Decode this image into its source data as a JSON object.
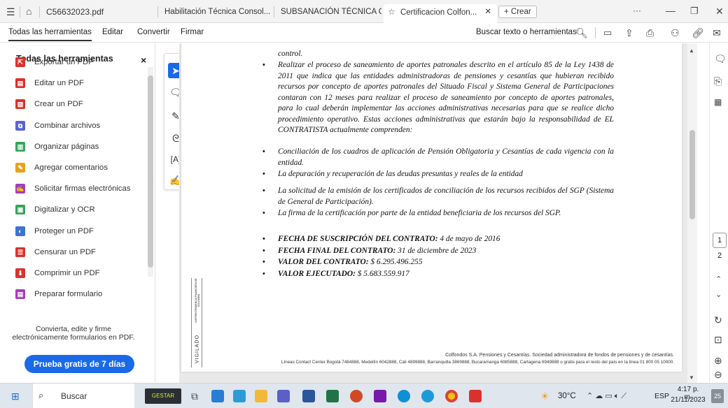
{
  "tabs": [
    {
      "label": "C56632023.pdf"
    },
    {
      "label": "Habilitación Técnica Consol..."
    },
    {
      "label": "SUBSANACIÓN TÉCNICA C..."
    },
    {
      "label": "Certificacion Colfon..."
    }
  ],
  "new_tab_label": "+ Crear",
  "menu": {
    "items": [
      "Todas las herramientas",
      "Editar",
      "Convertir",
      "Firmar"
    ],
    "search_label": "Buscar texto o herramientas"
  },
  "panel": {
    "title": "Todas las herramientas",
    "close": "×",
    "items": [
      {
        "label": "Exportar un PDF",
        "color": "#d9322d"
      },
      {
        "label": "Editar un PDF",
        "color": "#d9322d"
      },
      {
        "label": "Crear un PDF",
        "color": "#d9322d"
      },
      {
        "label": "Combinar archivos",
        "color": "#5b63d3"
      },
      {
        "label": "Organizar páginas",
        "color": "#3aa35c"
      },
      {
        "label": "Agregar comentarios",
        "color": "#e8a21b"
      },
      {
        "label": "Solicitar firmas electrónicas",
        "color": "#a43fb5"
      },
      {
        "label": "Digitalizar y OCR",
        "color": "#3aa35c"
      },
      {
        "label": "Proteger un PDF",
        "color": "#3d73d1"
      },
      {
        "label": "Censurar un PDF",
        "color": "#d9322d"
      },
      {
        "label": "Comprimir un PDF",
        "color": "#d9322d"
      },
      {
        "label": "Preparar formulario",
        "color": "#a43fb5"
      }
    ],
    "promo_text": "Convierta, edite y firme electrónicamente formularios en PDF.",
    "trial_button": "Prueba gratis de 7 días"
  },
  "document": {
    "top_fragment": "control.",
    "bullets": [
      "Realizar el proceso de saneamiento de aportes patronales descrito en el artículo 85 de la Ley 1438 de 2011 que indica que las entidades administradoras de pensiones y cesantías que hubieran recibido recursos por concepto de aportes patronales del Situado Fiscal y Sistema General de Participaciones contaran con 12 meses para realizar el proceso de saneamiento por concepto de aportes patronales, para lo cual deberán implementar las acciones administrativas necesarias para que se realice dicho procedimiento operativo. Estas acciones administrativas que estarán bajo la responsabilidad de EL CONTRATISTA actualmente comprenden:",
      "Conciliación de los cuadros de aplicación de Pensión Obligatoria y Cesantías de cada vigencia con la entidad.",
      "La depuración y recuperación de las deudas presuntas y reales de la entidad",
      "La solicitud de la emisión de los certificados de conciliación de los recursos recibidos del SGP (Sistema de General de Participación).",
      "La firma de la certificación por parte de la entidad beneficiaria de los recursos del SGP."
    ],
    "facts": [
      {
        "label": "FECHA DE SUSCRIPCIÓN DEL CONTRATO:",
        "value": "4 de mayo de 2016"
      },
      {
        "label": "FECHA FINAL DEL CONTRATO:",
        "value": "31 de diciembre de 2023"
      },
      {
        "label": "VALOR DEL CONTRATO:",
        "value": "$ 6.295.496.255"
      },
      {
        "label": "VALOR EJECUTADO:",
        "value": "$ 5.683.559.917"
      }
    ],
    "vigilado": "VIGILADO",
    "superintendencia": "SUPERINTENDENCIA FINANCIERA DE COLOMBIA",
    "footer_line1": "Colfondos S.A. Pensiones y Cesantías. Sociedad administradora de fondos de pensiones y de cesantías.",
    "footer_line2": "Líneas Contact Center Bogotá 7484888, Medellín 6042888, Cali 4899888, Barranquilla 3869888, Bucaramanga 6985888, Cartagena 6949888 o gratis para el resto del país en la línea 01 800 05 10000."
  },
  "page_numbers": [
    "1",
    "2"
  ],
  "taskbar": {
    "search_label": "Buscar",
    "weather": "30°C",
    "language": "ESP",
    "time": "4:17 p. m.",
    "date": "21/11/2023",
    "notifications": "25"
  }
}
